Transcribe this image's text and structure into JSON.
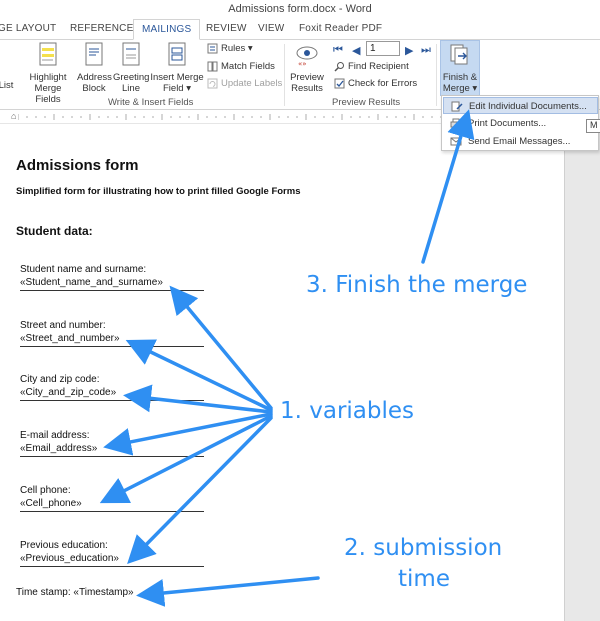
{
  "window": {
    "title": "Admissions form.docx - Word"
  },
  "tabs": [
    {
      "label": "GE LAYOUT"
    },
    {
      "label": "REFERENCES"
    },
    {
      "label": "MAILINGS"
    },
    {
      "label": "REVIEW"
    },
    {
      "label": "VIEW"
    },
    {
      "label": "Foxit Reader PDF"
    }
  ],
  "ribbon": {
    "list_label": "List",
    "highlight_merge_fields": [
      "Highlight",
      "Merge Fields"
    ],
    "address_block": [
      "Address",
      "Block"
    ],
    "greeting_line": [
      "Greeting",
      "Line"
    ],
    "insert_merge_field": [
      "Insert Merge",
      "Field ▾"
    ],
    "rules": "Rules ▾",
    "match_fields": "Match Fields",
    "update_labels": "Update Labels",
    "write_insert_group": "Write & Insert Fields",
    "preview_results": [
      "Preview",
      "Results"
    ],
    "record_number": "1",
    "find_recipient": "Find Recipient",
    "check_for_errors": "Check for Errors",
    "preview_results_group": "Preview Results",
    "finish_merge": [
      "Finish &",
      "Merge ▾"
    ]
  },
  "finish_menu": {
    "items": [
      {
        "label": "Edit Individual Documents..."
      },
      {
        "label": "Print Documents..."
      },
      {
        "label": "Send Email Messages..."
      }
    ],
    "tooltip_stub": "M"
  },
  "document": {
    "title": "Admissions form",
    "subtitle": "Simplified form for illustrating how to print filled Google Forms",
    "section": "Student data:",
    "fields": [
      {
        "label": "Student name and surname:",
        "value": "«Student_name_and_surname»"
      },
      {
        "label": "Street and number:",
        "value": "«Street_and_number»"
      },
      {
        "label": "City and zip code:",
        "value": "«City_and_zip_code»"
      },
      {
        "label": "E-mail address:",
        "value": "«Email_address»"
      },
      {
        "label": "Cell phone:",
        "value": "«Cell_phone»"
      },
      {
        "label": "Previous education:",
        "value": "«Previous_education»"
      }
    ],
    "timestamp": "Time stamp: «Timestamp»"
  },
  "annotations": {
    "finish": "3. Finish the merge",
    "variables": "1. variables",
    "submission_line1": "2. submission",
    "submission_line2": "time"
  },
  "colors": {
    "annotation_blue": "#2f8ff2",
    "word_blue": "#2b579a",
    "finish_highlight": "#c5d9f1",
    "menu_highlight": "#d5e1f2"
  }
}
